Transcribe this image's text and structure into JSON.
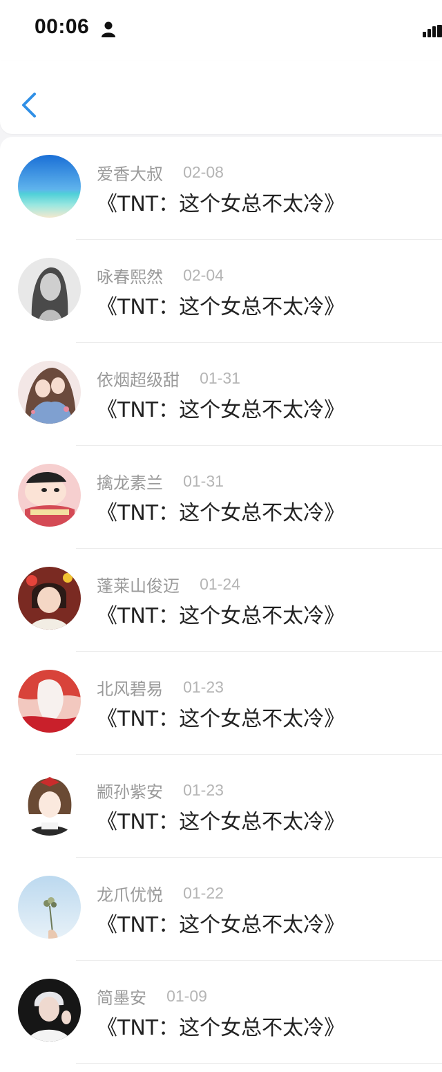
{
  "status_bar": {
    "time": "00:06"
  },
  "list": {
    "items": [
      {
        "name": "爱香大叔",
        "date": "02-08",
        "title": "《TNT：这个女总不太冷》"
      },
      {
        "name": "咏春熙然",
        "date": "02-04",
        "title": "《TNT：这个女总不太冷》"
      },
      {
        "name": "依烟超级甜",
        "date": "01-31",
        "title": "《TNT：这个女总不太冷》"
      },
      {
        "name": "擒龙素兰",
        "date": "01-31",
        "title": "《TNT：这个女总不太冷》"
      },
      {
        "name": "蓬莱山俊迈",
        "date": "01-24",
        "title": "《TNT：这个女总不太冷》"
      },
      {
        "name": "北风碧易",
        "date": "01-23",
        "title": "《TNT：这个女总不太冷》"
      },
      {
        "name": "颛孙紫安",
        "date": "01-23",
        "title": "《TNT：这个女总不太冷》"
      },
      {
        "name": "龙爪优悦",
        "date": "01-22",
        "title": "《TNT：这个女总不太冷》"
      },
      {
        "name": "简墨安",
        "date": "01-09",
        "title": "《TNT：这个女总不太冷》"
      }
    ]
  },
  "colors": {
    "accent": "#2f8fe6",
    "name_gray": "#9a9a9a",
    "date_gray": "#b5b5b5"
  }
}
